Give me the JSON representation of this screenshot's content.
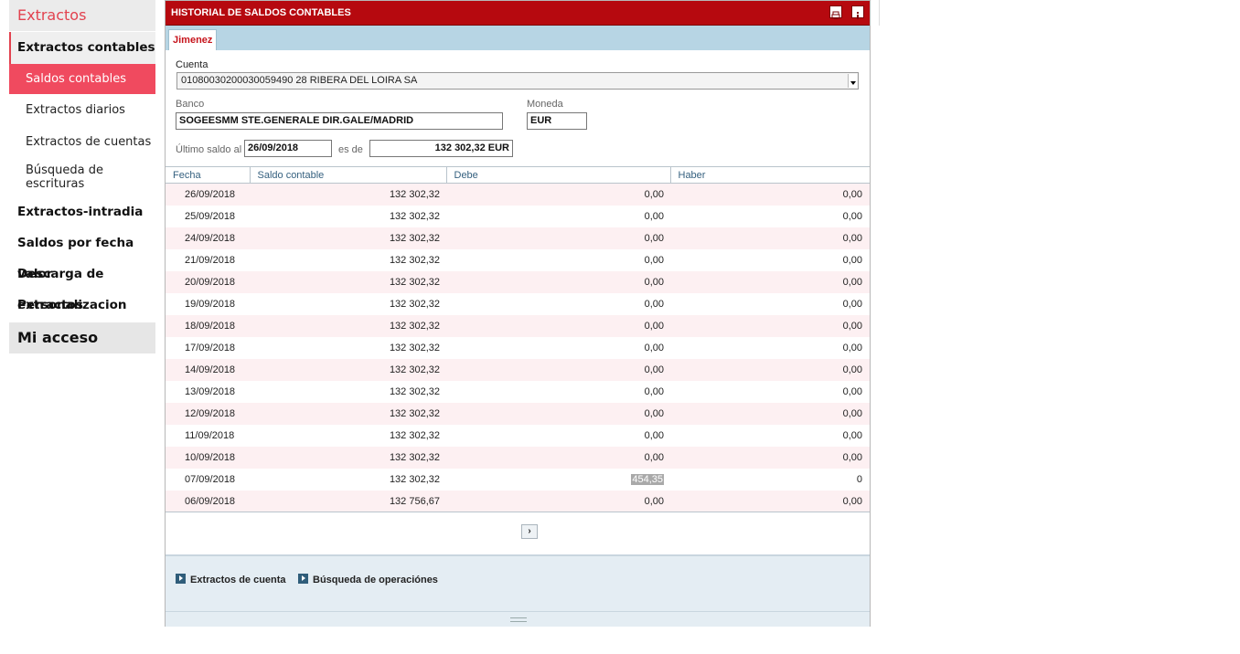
{
  "sidebar": {
    "section_title": "Extractos",
    "group_active": "Extractos contables",
    "sub_items": [
      "Saldos contables",
      "Extractos diarios",
      "Extractos de cuentas",
      "Búsqueda de escrituras"
    ],
    "groups": [
      "Extractos-intradia",
      "Saldos por fecha valor",
      "Descarga de extractos",
      "Personalizacion"
    ],
    "mi_acceso": "Mi acceso"
  },
  "window": {
    "title": "HISTORIAL DE SALDOS CONTABLES",
    "tab": "Jimenez",
    "icons": [
      "print-icon",
      "info-icon"
    ]
  },
  "form": {
    "cuenta_label": "Cuenta",
    "cuenta_value": "01080030200030059490 28 RIBERA DEL LOIRA SA",
    "banco_label": "Banco",
    "banco_value": "SOGEESMM STE.GENERALE DIR.GALE/MADRID",
    "moneda_label": "Moneda",
    "moneda_value": "EUR",
    "ultimo_label": "Último saldo al",
    "ultimo_date": "26/09/2018",
    "es_de_label": "es de",
    "ultimo_amount": "132 302,32 EUR"
  },
  "table": {
    "headers": [
      "Fecha",
      "Saldo contable",
      "Debe",
      "Haber"
    ],
    "rows": [
      [
        "26/09/2018",
        "132 302,32",
        "0,00",
        "0,00"
      ],
      [
        "25/09/2018",
        "132 302,32",
        "0,00",
        "0,00"
      ],
      [
        "24/09/2018",
        "132 302,32",
        "0,00",
        "0,00"
      ],
      [
        "21/09/2018",
        "132 302,32",
        "0,00",
        "0,00"
      ],
      [
        "20/09/2018",
        "132 302,32",
        "0,00",
        "0,00"
      ],
      [
        "19/09/2018",
        "132 302,32",
        "0,00",
        "0,00"
      ],
      [
        "18/09/2018",
        "132 302,32",
        "0,00",
        "0,00"
      ],
      [
        "17/09/2018",
        "132 302,32",
        "0,00",
        "0,00"
      ],
      [
        "14/09/2018",
        "132 302,32",
        "0,00",
        "0,00"
      ],
      [
        "13/09/2018",
        "132 302,32",
        "0,00",
        "0,00"
      ],
      [
        "12/09/2018",
        "132 302,32",
        "0,00",
        "0,00"
      ],
      [
        "11/09/2018",
        "132 302,32",
        "0,00",
        "0,00"
      ],
      [
        "10/09/2018",
        "132 302,32",
        "0,00",
        "0,00"
      ],
      [
        "07/09/2018",
        "132 302,32",
        "454,35",
        "0"
      ],
      [
        "06/09/2018",
        "132 756,67",
        "0,00",
        "0,00"
      ]
    ]
  },
  "pager": {
    "next_label": "›"
  },
  "footer": {
    "link1": "Extractos de cuenta",
    "link2": "Búsqueda de operaciónes"
  },
  "colors": {
    "brand_red": "#b6090f",
    "accent_pink": "#f04a5f",
    "tab_bar": "#b7d5e4"
  }
}
